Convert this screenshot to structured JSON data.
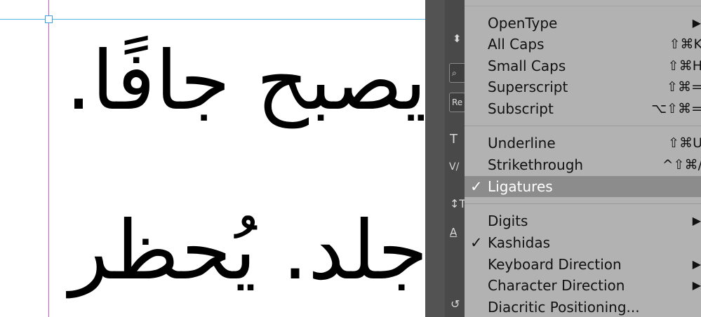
{
  "canvas": {
    "line1": "يصبح جافًا.",
    "line2": "جلد. يُحظر"
  },
  "panel": {
    "box1_text": "Re",
    "icons": [
      "↕",
      "🔍",
      "T",
      "V/A",
      "↕T",
      "A"
    ]
  },
  "menu": {
    "items": [
      {
        "label": "OpenType",
        "shortcut": "",
        "submenu": true,
        "checked": false
      },
      {
        "label": "All Caps",
        "shortcut": "⇧⌘K",
        "submenu": false,
        "checked": false
      },
      {
        "label": "Small Caps",
        "shortcut": "⇧⌘H",
        "submenu": false,
        "checked": false
      },
      {
        "label": "Superscript",
        "shortcut": "⇧⌘=",
        "submenu": false,
        "checked": false
      },
      {
        "label": "Subscript",
        "shortcut": "⌥⇧⌘=",
        "submenu": false,
        "checked": false
      },
      {
        "label": "Underline",
        "shortcut": "⇧⌘U",
        "submenu": false,
        "checked": false
      },
      {
        "label": "Strikethrough",
        "shortcut": "^⇧⌘/",
        "submenu": false,
        "checked": false
      },
      {
        "label": "Ligatures",
        "shortcut": "",
        "submenu": false,
        "checked": true,
        "highlighted": true
      },
      {
        "label": "Digits",
        "shortcut": "",
        "submenu": true,
        "checked": false
      },
      {
        "label": "Kashidas",
        "shortcut": "",
        "submenu": false,
        "checked": true
      },
      {
        "label": "Keyboard Direction",
        "shortcut": "",
        "submenu": true,
        "checked": false
      },
      {
        "label": "Character Direction",
        "shortcut": "",
        "submenu": true,
        "checked": false
      },
      {
        "label": "Diacritic Positioning...",
        "shortcut": "",
        "submenu": false,
        "checked": false
      }
    ],
    "check_glyph": "✓",
    "arrow_glyph": "▶"
  }
}
